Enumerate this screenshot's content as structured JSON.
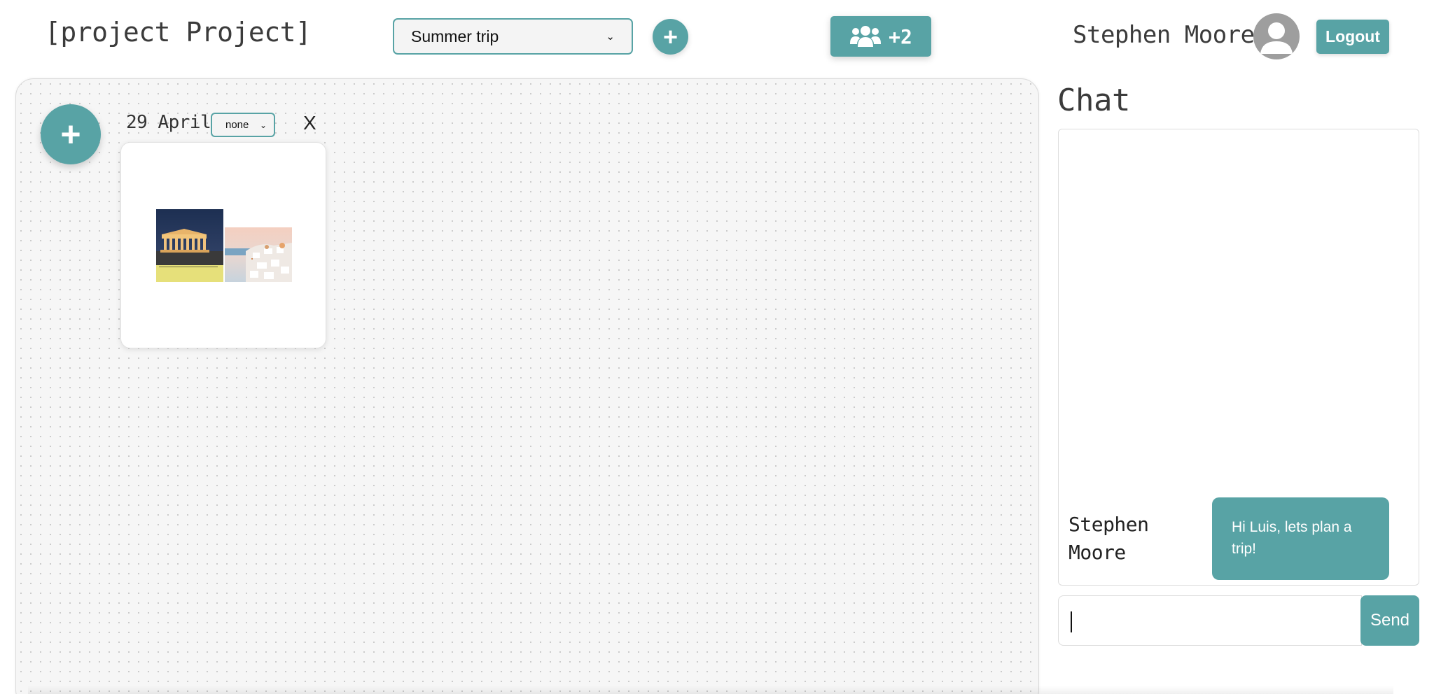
{
  "header": {
    "app_title": "[project Project]",
    "project_select": {
      "selected": "Summer trip"
    },
    "add_project_icon": "plus-icon",
    "members": {
      "icon": "users-icon",
      "count": "+2"
    },
    "user_name": "Stephen Moore",
    "avatar_icon": "user-avatar-icon",
    "logout_label": "Logout"
  },
  "board": {
    "add_card_icon": "plus-icon",
    "card": {
      "date": "29 April",
      "status_select": {
        "selected": "none"
      },
      "close_label": "X",
      "images": [
        "acropolis-photo",
        "santorini-photo"
      ]
    }
  },
  "chat": {
    "heading": "Chat",
    "messages": [
      {
        "sender": "Stephen Moore",
        "text": "Hi Luis, lets plan a trip!"
      }
    ],
    "input": {
      "value": "",
      "placeholder": ""
    },
    "send_label": "Send"
  },
  "colors": {
    "accent": "#58a3a5",
    "board_background": "#f6f6f6",
    "text": "#3b3b3b"
  }
}
